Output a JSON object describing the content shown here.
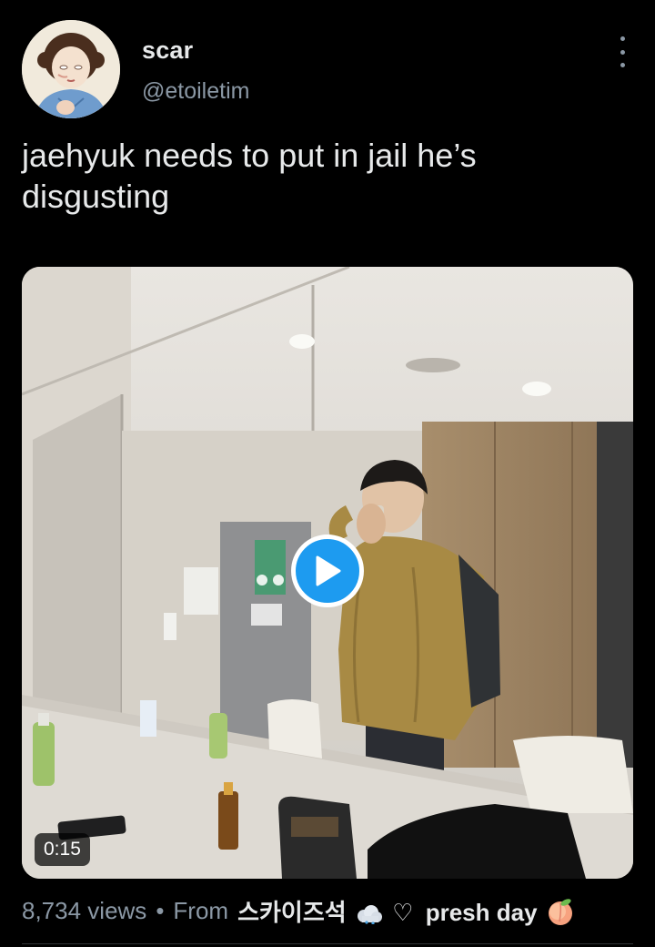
{
  "author": {
    "display_name": "scar",
    "handle": "@etoiletim",
    "avatar": "avatar-illustration"
  },
  "tweet": {
    "text": "jaehyuk needs to put in jail he’s disgusting"
  },
  "media": {
    "type": "video",
    "duration": "0:15",
    "play_icon": "play-icon"
  },
  "footer": {
    "views": "8,734 views",
    "separator": "•",
    "from_label": "From",
    "source_korean": "스카이즈석",
    "source_heart": "♡",
    "source_name": "presh day",
    "icons": [
      "cloud-icon",
      "peach-icon"
    ]
  },
  "colors": {
    "background": "#000000",
    "text_primary": "#e7e9ea",
    "text_secondary": "#8b98a5",
    "accent": "#1d9bf0"
  }
}
